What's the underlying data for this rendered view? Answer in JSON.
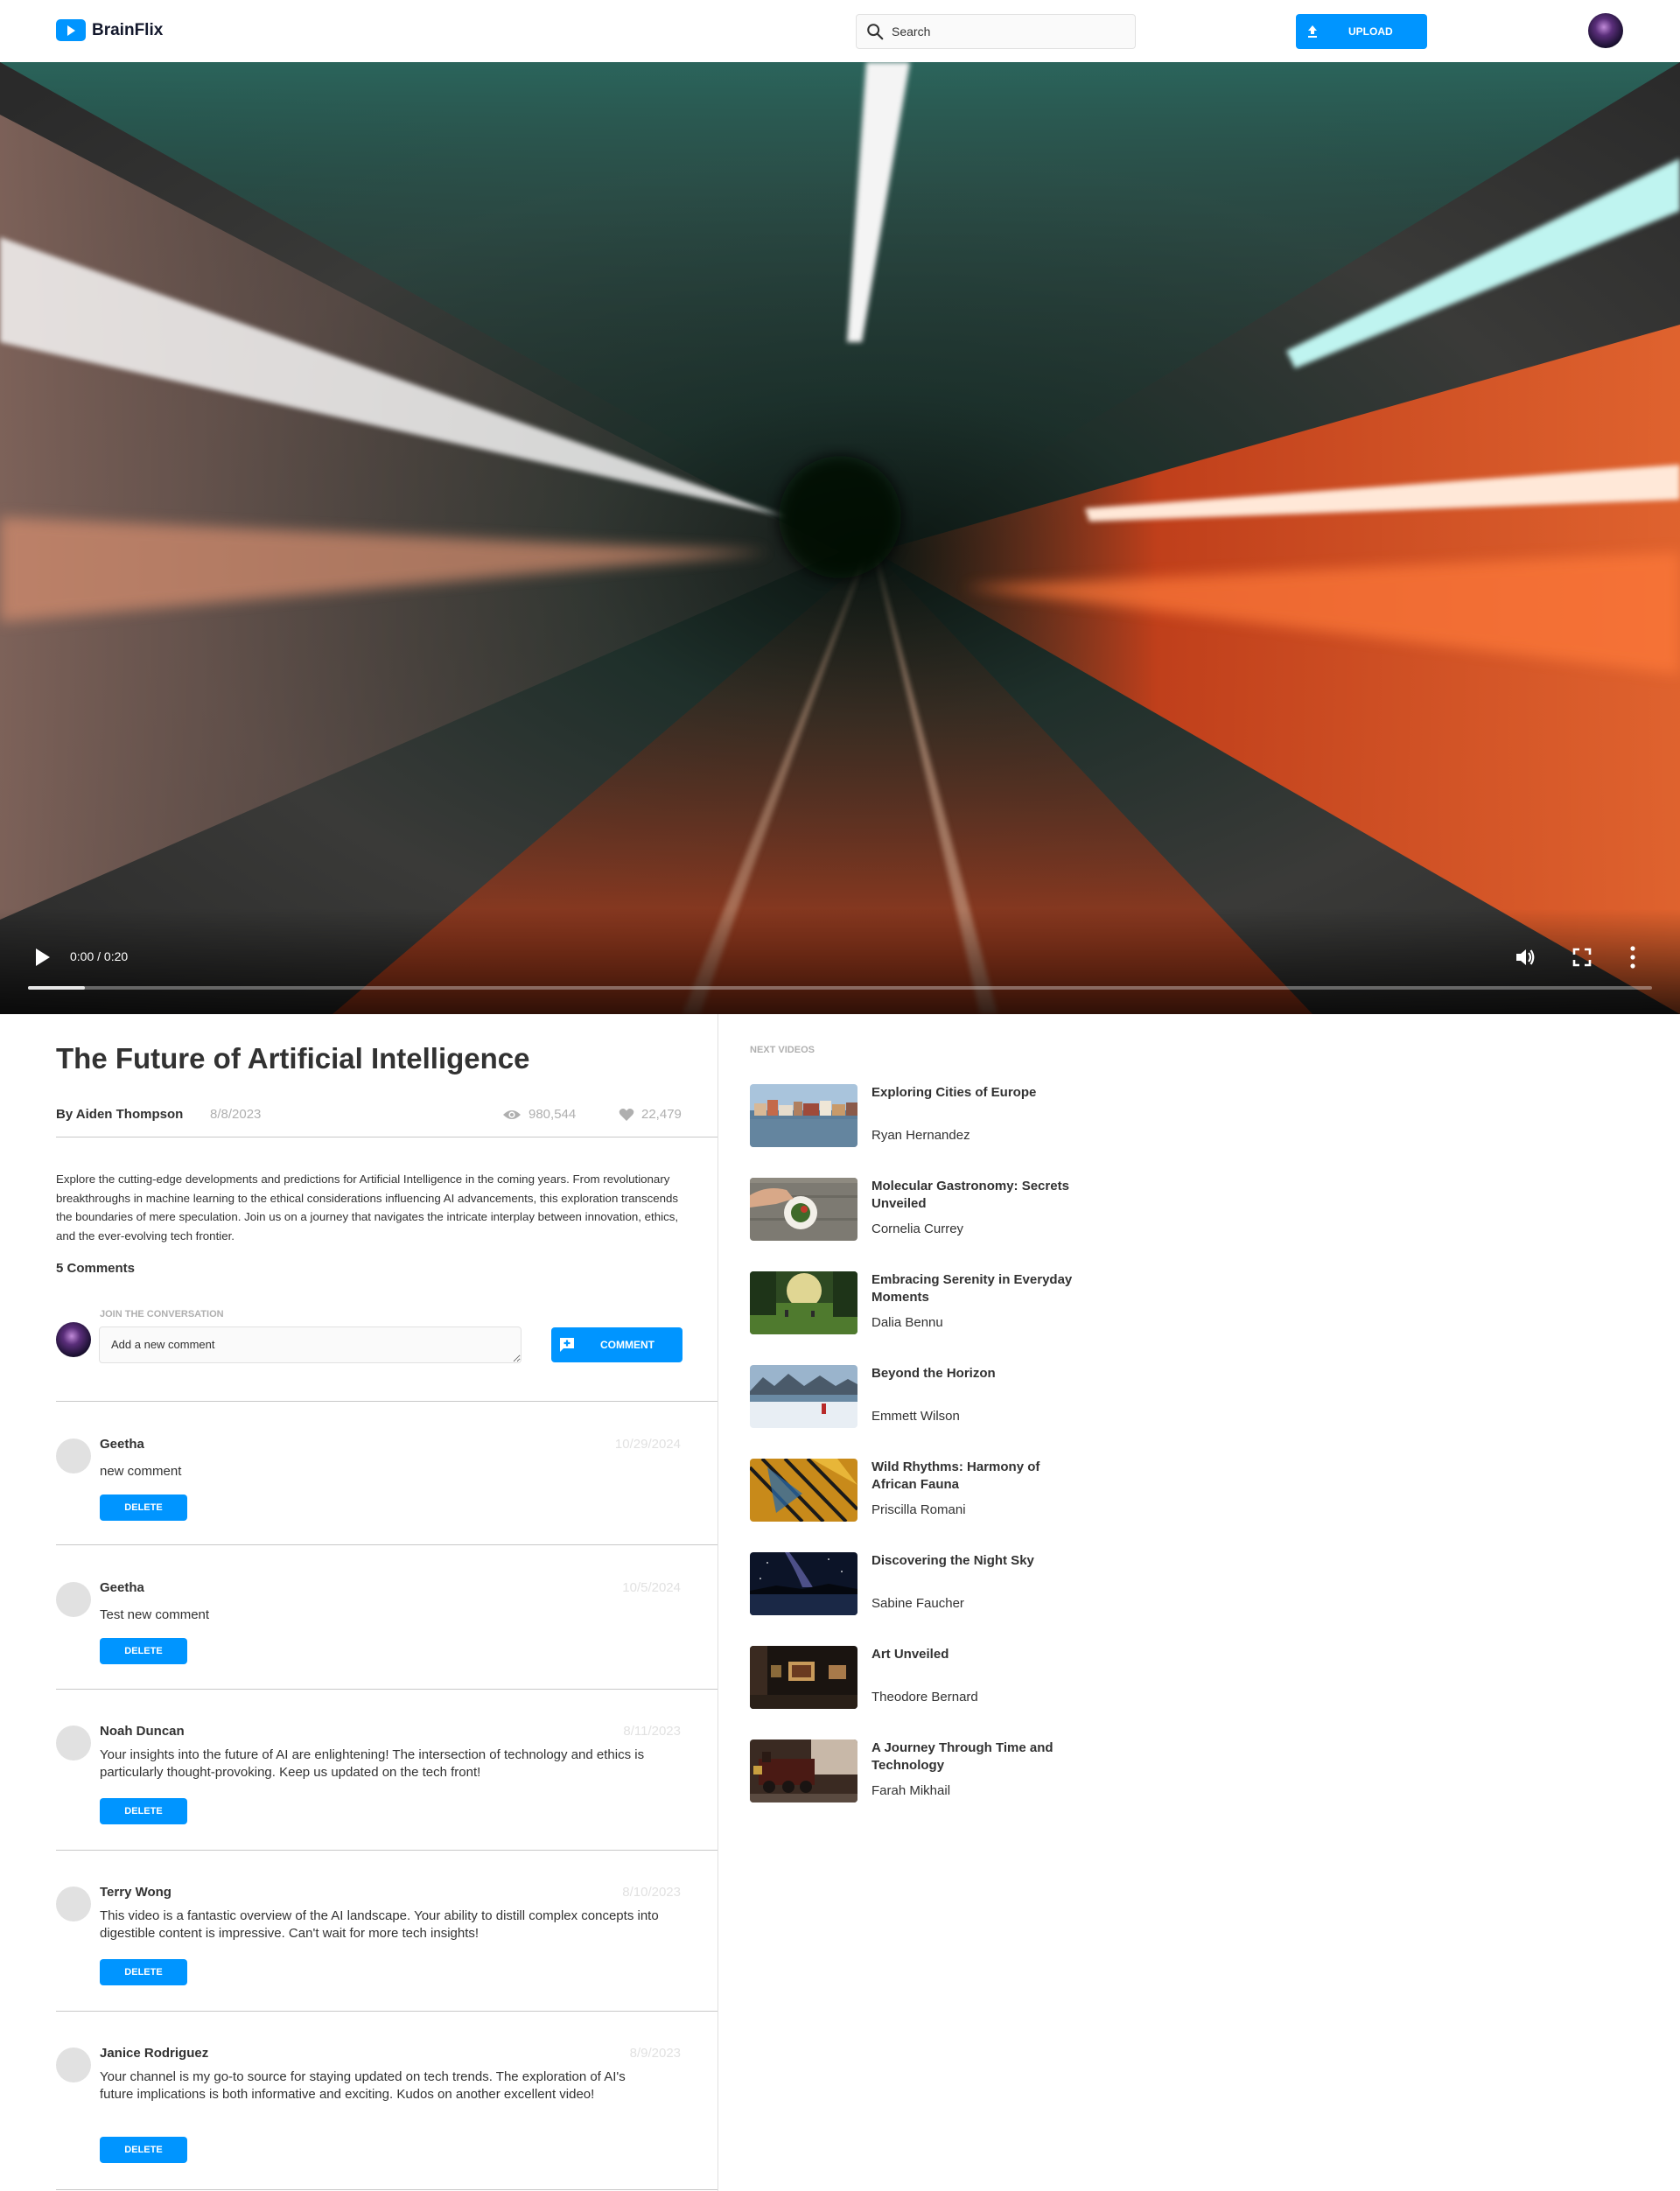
{
  "header": {
    "brand": "BrainFlix",
    "search_placeholder": "Search",
    "upload_label": "UPLOAD"
  },
  "player": {
    "time": "0:00 / 0:20",
    "progress_fraction": 0.035
  },
  "video": {
    "title": "The Future of Artificial Intelligence",
    "byline": "By Aiden Thompson",
    "date": "8/8/2023",
    "views": "980,544",
    "likes": "22,479",
    "description": "Explore the cutting-edge developments and predictions for Artificial Intelligence in the coming years. From revolutionary breakthroughs in machine learning to the ethical considerations influencing AI advancements, this exploration transcends the boundaries of mere speculation. Join us on a journey that navigates the intricate interplay between innovation, ethics, and the ever-evolving tech frontier."
  },
  "comments_section": {
    "count_label": "5 Comments",
    "join_label": "JOIN THE CONVERSATION",
    "input_placeholder": "Add a new comment",
    "submit_label": "COMMENT",
    "delete_label": "DELETE"
  },
  "comments": [
    {
      "name": "Geetha",
      "date": "10/29/2024",
      "text": "new comment"
    },
    {
      "name": "Geetha",
      "date": "10/5/2024",
      "text": "Test new comment"
    },
    {
      "name": "Noah Duncan",
      "date": "8/11/2023",
      "text": "Your insights into the future of AI are enlightening! The intersection of technology and ethics is particularly thought-provoking. Keep us updated on the tech front!"
    },
    {
      "name": "Terry Wong",
      "date": "8/10/2023",
      "text": "This video is a fantastic overview of the AI landscape. Your ability to distill complex concepts into digestible content is impressive. Can't wait for more tech insights!"
    },
    {
      "name": "Janice Rodriguez",
      "date": "8/9/2023",
      "text": "Your channel is my go-to source for staying updated on tech trends. The exploration of AI's future implications is both informative and exciting. Kudos on another excellent video!"
    }
  ],
  "sidebar": {
    "heading": "NEXT VIDEOS",
    "videos": [
      {
        "title": "Exploring Cities of Europe",
        "author": "Ryan Hernandez"
      },
      {
        "title": "Molecular Gastronomy: Secrets Unveiled",
        "author": "Cornelia Currey"
      },
      {
        "title": "Embracing Serenity in Everyday Moments",
        "author": "Dalia Bennu"
      },
      {
        "title": "Beyond the Horizon",
        "author": "Emmett Wilson"
      },
      {
        "title": "Wild Rhythms: Harmony of African Fauna",
        "author": "Priscilla Romani"
      },
      {
        "title": "Discovering the Night Sky",
        "author": "Sabine Faucher"
      },
      {
        "title": "Art Unveiled",
        "author": "Theodore Bernard"
      },
      {
        "title": "A Journey Through Time and Technology",
        "author": "Farah Mikhail"
      }
    ]
  },
  "colors": {
    "accent": "#0095ff",
    "text": "#323232",
    "muted": "#afafaf",
    "divider": "#c8c8c8"
  }
}
